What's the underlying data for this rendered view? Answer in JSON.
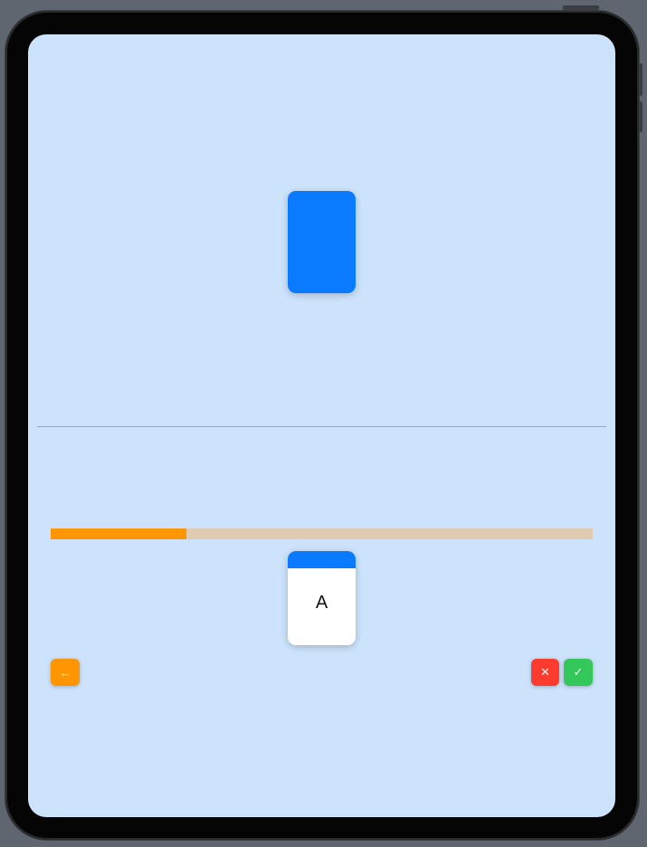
{
  "progress": {
    "fraction": 0.25
  },
  "card": {
    "letter": "A"
  },
  "buttons": {
    "back_icon": "←",
    "back_icon_name": "arrow-left-icon",
    "wrong_icon": "✕",
    "wrong_icon_name": "close-icon",
    "right_icon": "✓",
    "right_icon_name": "checkmark-icon"
  },
  "colors": {
    "background": "#cce3fb",
    "card_blue": "#0a7aff",
    "progress_fill": "#ff9500",
    "progress_track": "#dfccb0",
    "back_button": "#ff9500",
    "wrong_button": "#ff3b30",
    "right_button": "#34c759"
  }
}
